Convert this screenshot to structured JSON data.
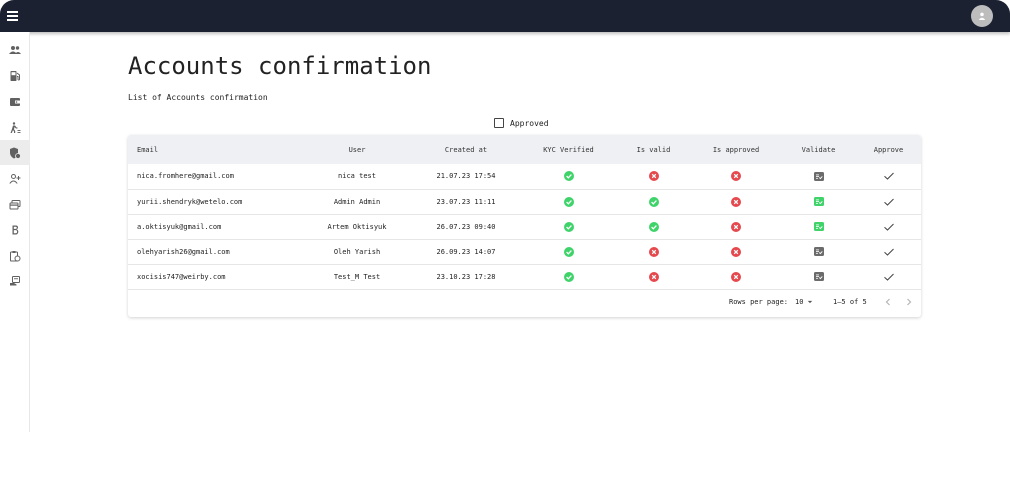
{
  "topbar": {
    "avatar_initial": ""
  },
  "sidebar": {
    "items": [
      {
        "icon": "people-icon",
        "active": false
      },
      {
        "icon": "gas-station-icon",
        "active": false
      },
      {
        "icon": "wallet-icon",
        "active": false
      },
      {
        "icon": "walking-person-icon",
        "active": false
      },
      {
        "icon": "shield-check-icon",
        "active": true
      },
      {
        "icon": "person-add-icon",
        "active": false
      },
      {
        "icon": "cards-icon",
        "active": false
      },
      {
        "icon": "bitcoin-icon",
        "active": false
      },
      {
        "icon": "clipboard-timer-icon",
        "active": false
      },
      {
        "icon": "receipt-hand-icon",
        "active": false
      }
    ]
  },
  "page": {
    "title": "Accounts confirmation",
    "subtitle": "List of Accounts confirmation"
  },
  "filter": {
    "label": "Approved",
    "checked": false
  },
  "table": {
    "columns": [
      "Email",
      "User",
      "Created at",
      "KYC Verified",
      "Is valid",
      "Is approved",
      "Validate",
      "Approve"
    ],
    "rows": [
      {
        "email": "nica.fromhere@gmail.com",
        "user": "nica test",
        "created_at": "21.07.23 17:54",
        "kyc_verified": true,
        "is_valid": false,
        "is_approved": false,
        "validate": "gray"
      },
      {
        "email": "yurii.shendryk@wetelo.com",
        "user": "Admin Admin",
        "created_at": "23.07.23 11:11",
        "kyc_verified": true,
        "is_valid": true,
        "is_approved": false,
        "validate": "green"
      },
      {
        "email": "a.oktisyuk@gmail.com",
        "user": "Artem Oktisyuk",
        "created_at": "26.07.23 09:40",
        "kyc_verified": true,
        "is_valid": true,
        "is_approved": false,
        "validate": "green"
      },
      {
        "email": "olehyarish26@gmail.com",
        "user": "Oleh Yarish",
        "created_at": "26.09.23 14:07",
        "kyc_verified": true,
        "is_valid": false,
        "is_approved": false,
        "validate": "gray"
      },
      {
        "email": "xocisis747@weirby.com",
        "user": "Test_M Test",
        "created_at": "23.10.23 17:28",
        "kyc_verified": true,
        "is_valid": false,
        "is_approved": false,
        "validate": "gray"
      }
    ]
  },
  "pagination": {
    "rows_per_page_label": "Rows per page:",
    "rows_per_page": "10",
    "range": "1–5 of 5"
  },
  "colors": {
    "topbar": "#1c2131",
    "success": "#3fd36a",
    "error": "#e5484d",
    "validate_gray": "#6b6b6b",
    "header_bg": "#eef0f3"
  }
}
